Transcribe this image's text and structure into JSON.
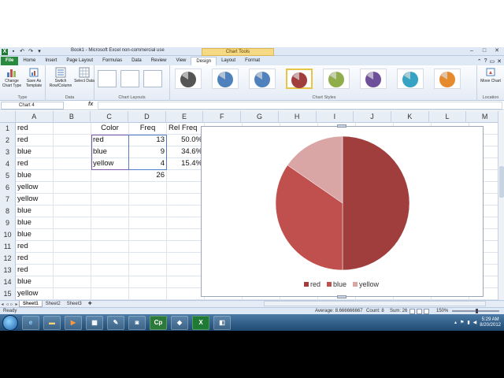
{
  "window": {
    "app_title": "Book1 - Microsoft Excel non-commercial use",
    "chart_tools_label": "Chart Tools",
    "file_tab": "File"
  },
  "ribbon_tabs": [
    "Home",
    "Insert",
    "Page Layout",
    "Formulas",
    "Data",
    "Review",
    "View",
    "Design",
    "Layout",
    "Format"
  ],
  "ribbon": {
    "type_group": "Type",
    "data_group": "Data",
    "layouts_group": "Chart Layouts",
    "styles_group": "Chart Styles",
    "location_group": "Location",
    "change_chart_type": "Change Chart Type",
    "save_as_template": "Save As Template",
    "switch_row_column": "Switch Row/Column",
    "select_data": "Select Data",
    "move_chart": "Move Chart"
  },
  "formula_bar": {
    "name_box": "Chart 4",
    "fx": "fx"
  },
  "columns": [
    "A",
    "B",
    "C",
    "D",
    "E",
    "F",
    "G",
    "H",
    "I",
    "J",
    "K",
    "L",
    "M"
  ],
  "rows": [
    {
      "n": "1",
      "a": "red",
      "c": "Color",
      "d": "Freq",
      "e": "Rel Freq"
    },
    {
      "n": "2",
      "a": "red",
      "c": "red",
      "d": "13",
      "e": "50.0%"
    },
    {
      "n": "3",
      "a": "blue",
      "c": "blue",
      "d": "9",
      "e": "34.6%"
    },
    {
      "n": "4",
      "a": "red",
      "c": "yellow",
      "d": "4",
      "e": "15.4%"
    },
    {
      "n": "5",
      "a": "blue",
      "c": "",
      "d": "26",
      "e": ""
    },
    {
      "n": "6",
      "a": "yellow",
      "c": "",
      "d": "",
      "e": ""
    },
    {
      "n": "7",
      "a": "yellow",
      "c": "",
      "d": "",
      "e": ""
    },
    {
      "n": "8",
      "a": "blue",
      "c": "",
      "d": "",
      "e": ""
    },
    {
      "n": "9",
      "a": "blue",
      "c": "",
      "d": "",
      "e": ""
    },
    {
      "n": "10",
      "a": "blue",
      "c": "",
      "d": "",
      "e": ""
    },
    {
      "n": "11",
      "a": "red",
      "c": "",
      "d": "",
      "e": ""
    },
    {
      "n": "12",
      "a": "red",
      "c": "",
      "d": "",
      "e": ""
    },
    {
      "n": "13",
      "a": "red",
      "c": "",
      "d": "",
      "e": ""
    },
    {
      "n": "14",
      "a": "blue",
      "c": "",
      "d": "",
      "e": ""
    },
    {
      "n": "15",
      "a": "yellow",
      "c": "",
      "d": "",
      "e": ""
    }
  ],
  "chart_data": {
    "type": "pie",
    "categories": [
      "red",
      "blue",
      "yellow"
    ],
    "values": [
      13,
      9,
      4
    ],
    "colors": [
      "#a03e3e",
      "#c0504d",
      "#d9a5a5"
    ],
    "legend_position": "bottom"
  },
  "sheets": [
    "Sheet1",
    "Sheet2",
    "Sheet3"
  ],
  "status": {
    "ready": "Ready",
    "average": "Average: 8.666666667",
    "count": "Count: 8",
    "sum": "Sum: 26",
    "zoom": "150%"
  },
  "taskbar": {
    "time": "5:29 AM",
    "date": "8/20/2012"
  }
}
